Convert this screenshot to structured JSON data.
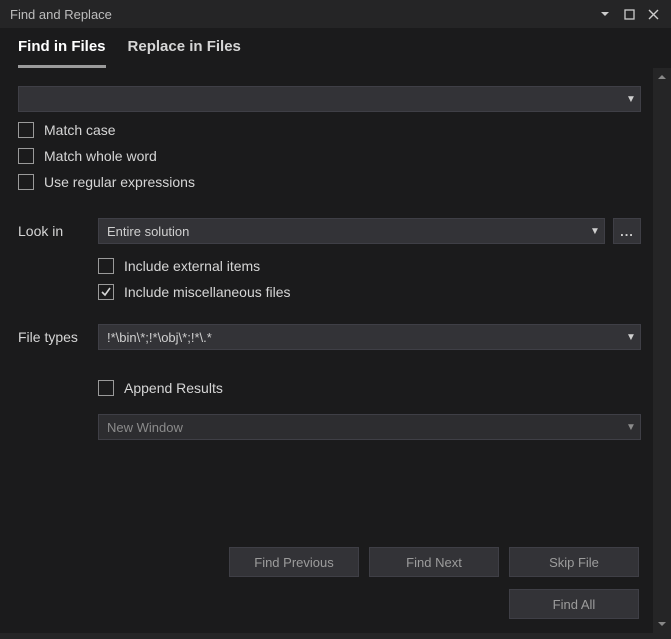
{
  "window": {
    "title": "Find and Replace"
  },
  "tabs": {
    "find": "Find in Files",
    "replace": "Replace in Files",
    "active": "find"
  },
  "search": {
    "value": ""
  },
  "options": {
    "match_case": "Match case",
    "match_whole_word": "Match whole word",
    "use_regex": "Use regular expressions"
  },
  "look_in": {
    "label": "Look in",
    "value": "Entire solution",
    "browse": "...",
    "include_external": "Include external items",
    "include_misc": "Include miscellaneous files"
  },
  "file_types": {
    "label": "File types",
    "value": "!*\\bin\\*;!*\\obj\\*;!*\\.*"
  },
  "results": {
    "append": "Append Results",
    "target": "New Window"
  },
  "buttons": {
    "find_previous": "Find Previous",
    "find_next": "Find Next",
    "skip_file": "Skip File",
    "find_all": "Find All"
  }
}
